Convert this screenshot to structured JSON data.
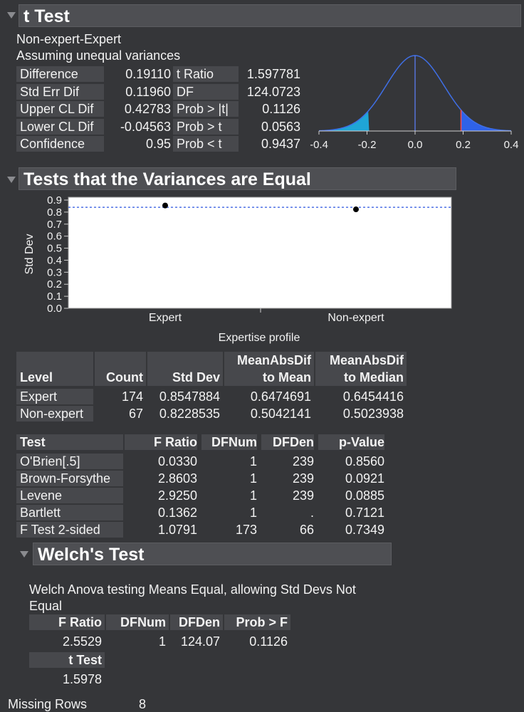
{
  "ttest": {
    "title": "t Test",
    "comparison": "Non-expert-Expert",
    "assumption": "Assuming unequal variances",
    "rows": [
      {
        "label": "Difference",
        "value": "0.19110",
        "label2": "t Ratio",
        "value2": "1.597781"
      },
      {
        "label": "Std Err Dif",
        "value": "0.11960",
        "label2": "DF",
        "value2": "124.0723"
      },
      {
        "label": "Upper CL Dif",
        "value": "0.42783",
        "label2": "Prob > |t|",
        "value2": "0.1126"
      },
      {
        "label": "Lower CL Dif",
        "value": "-0.04563",
        "label2": "Prob > t",
        "value2": "0.0563"
      },
      {
        "label": "Confidence",
        "value": "0.95",
        "label2": "Prob < t",
        "value2": "0.9437"
      }
    ],
    "dist_ticks": [
      "-0.4",
      "-0.2",
      "0.0",
      "0.2",
      "0.4"
    ],
    "colors": {
      "curve": "#3f6fe6",
      "left_tail": "#1fa5d6",
      "right_tail": "#2f62e8",
      "marker": "#ff4a4a",
      "center": "#5a7cf0"
    }
  },
  "variances": {
    "title": "Tests that the Variances are Equal",
    "chart_data": {
      "type": "scatter",
      "categories": [
        "Expert",
        "Non-expert"
      ],
      "values": [
        0.8547884,
        0.8228535
      ],
      "reference_line": 0.84,
      "ylabel": "Std Dev",
      "xlabel": "Expertise profile",
      "ylim": [
        0,
        0.9
      ],
      "yticks": [
        "0.0",
        "0.1",
        "0.2",
        "0.3",
        "0.4",
        "0.5",
        "0.6",
        "0.7",
        "0.8",
        "0.9"
      ]
    },
    "level_table": {
      "headers": [
        [
          "",
          "Level"
        ],
        [
          "",
          "Count"
        ],
        [
          "",
          "Std Dev"
        ],
        [
          "MeanAbsDif",
          "to Mean"
        ],
        [
          "MeanAbsDif",
          "to Median"
        ]
      ],
      "rows": [
        [
          "Expert",
          "174",
          "0.8547884",
          "0.6474691",
          "0.6454416"
        ],
        [
          "Non-expert",
          "67",
          "0.8228535",
          "0.5042141",
          "0.5023938"
        ]
      ]
    },
    "test_table": {
      "headers": [
        "Test",
        "F Ratio",
        "DFNum",
        "DFDen",
        "p-Value"
      ],
      "rows": [
        [
          "O'Brien[.5]",
          "0.0330",
          "1",
          "239",
          "0.8560"
        ],
        [
          "Brown-Forsythe",
          "2.8603",
          "1",
          "239",
          "0.0921"
        ],
        [
          "Levene",
          "2.9250",
          "1",
          "239",
          "0.0885"
        ],
        [
          "Bartlett",
          "0.1362",
          "1",
          ".",
          "0.7121"
        ],
        [
          "F Test 2-sided",
          "1.0791",
          "173",
          "66",
          "0.7349"
        ]
      ]
    }
  },
  "welch": {
    "title": "Welch's Test",
    "description_line1": "Welch Anova testing Means Equal, allowing Std Devs Not",
    "description_line2": "Equal",
    "headers": [
      "F Ratio",
      "DFNum",
      "DFDen",
      "Prob > F"
    ],
    "values": [
      "2.5529",
      "1",
      "124.07",
      "0.1126"
    ],
    "t_label": "t Test",
    "t_value": "1.5978"
  },
  "footer": {
    "label": "Missing Rows",
    "value": "8"
  }
}
